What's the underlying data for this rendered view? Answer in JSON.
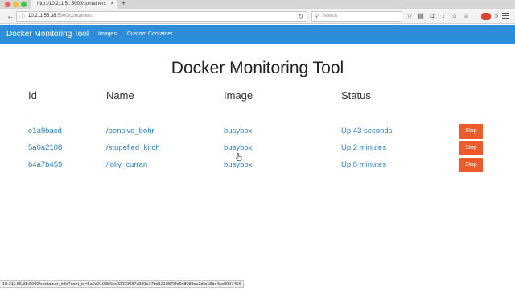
{
  "browser": {
    "tab_title": "http://10.211.5...5000/containers",
    "url_host": "10.211.55.38",
    "url_path": ":5000/containers",
    "search_placeholder": "Search",
    "status_url": "10.211.55.38:5000/container_info?cont_id=5a0a2108b6ce02029937c820e37bd1218873fd9c8083ac2dfa18bc4ac9097456"
  },
  "navbar": {
    "brand": "Docker Monitoring Tool",
    "links": [
      "Images",
      "Custom Container"
    ],
    "color": "#2d8dd8"
  },
  "page": {
    "title": "Docker Monitoring Tool",
    "columns": [
      "Id",
      "Name",
      "Image",
      "Status"
    ],
    "stop_label": "Stop",
    "stop_color": "#ee5a2a",
    "link_color": "#2e7fc4",
    "containers": [
      {
        "id": "e1a9bacd",
        "name": "/pensive_bohr",
        "image": "busybox",
        "status": "Up 43 seconds"
      },
      {
        "id": "5a0a2108",
        "name": "/stupefied_kirch",
        "image": "busybox",
        "status": "Up 2 minutes"
      },
      {
        "id": "b4a7b459",
        "name": "/jolly_curran",
        "image": "busybox",
        "status": "Up 8 minutes"
      }
    ]
  }
}
